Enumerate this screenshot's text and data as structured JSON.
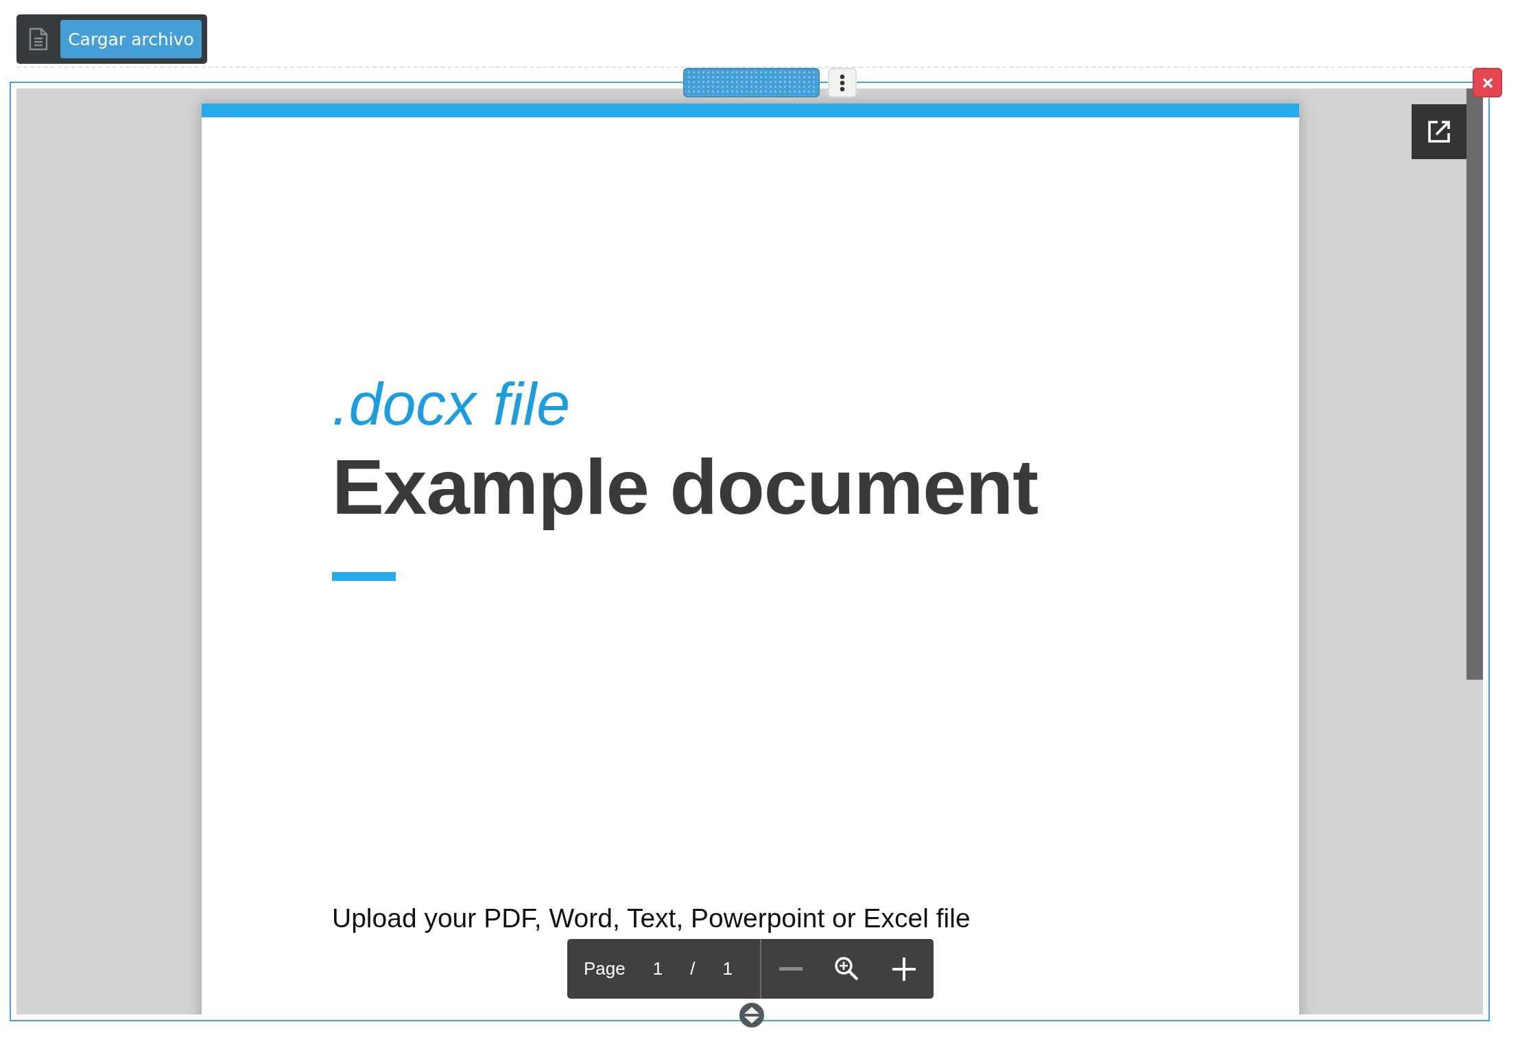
{
  "toolbar": {
    "upload_button": "Cargar archivo"
  },
  "document": {
    "subtitle": ".docx file",
    "title": "Example document",
    "body": "Upload your PDF, Word, Text, Powerpoint or Excel file"
  },
  "pager": {
    "label": "Page",
    "current": "1",
    "separator": "/",
    "total": "1",
    "zoom_out": {
      "disabled": true
    },
    "zoom_in": {
      "disabled": false
    }
  }
}
